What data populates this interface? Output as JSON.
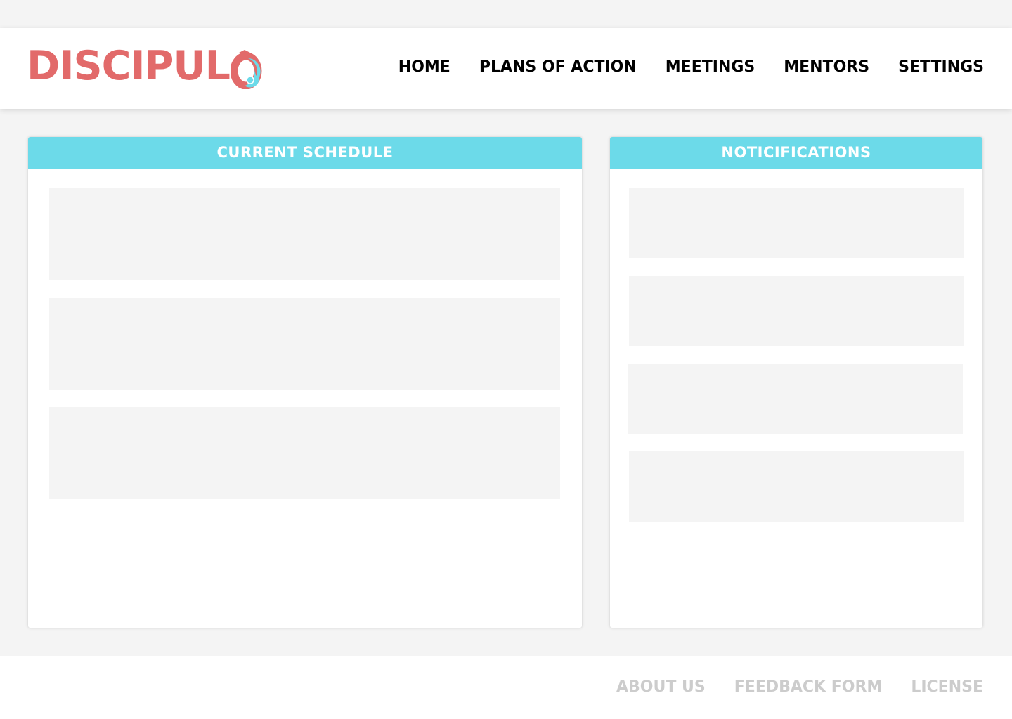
{
  "brand": {
    "name": "DISCIPULO",
    "wordmark": "DISCIPUL",
    "logo_icon": "graduation-cap-o-icon",
    "colors": {
      "primary": "#e26a6a",
      "accent": "#6cdae9",
      "muted": "#cccccc",
      "background": "#f4f4f4"
    }
  },
  "nav": {
    "items": [
      {
        "label": "HOME"
      },
      {
        "label": "PLANS OF ACTION"
      },
      {
        "label": "MEETINGS"
      },
      {
        "label": "MENTORS"
      },
      {
        "label": "SETTINGS"
      }
    ]
  },
  "schedule": {
    "title": "CURRENT SCHEDULE",
    "items": [
      {},
      {},
      {}
    ]
  },
  "notifications": {
    "title": "NOTICIFICATIONS",
    "items": [
      {},
      {},
      {},
      {}
    ]
  },
  "footer": {
    "links": [
      {
        "label": "ABOUT US"
      },
      {
        "label": "FEEDBACK FORM"
      },
      {
        "label": "LICENSE"
      }
    ]
  }
}
